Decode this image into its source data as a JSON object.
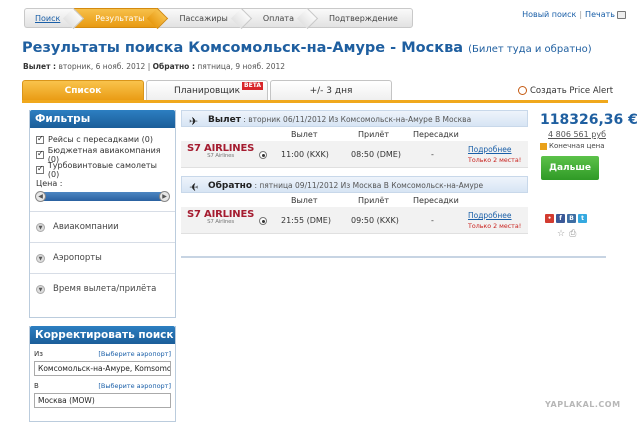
{
  "steps": [
    {
      "label": "Поиск",
      "state": "link"
    },
    {
      "label": "Результаты",
      "state": "active"
    },
    {
      "label": "Пассажиры",
      "state": "normal"
    },
    {
      "label": "Оплата",
      "state": "normal"
    },
    {
      "label": "Подтверждение",
      "state": "normal"
    }
  ],
  "toplinks": {
    "new_search": "Новый поиск",
    "separator": "|",
    "print": "Печать"
  },
  "title": {
    "main": "Результаты поиска Комсомольск-на-Амуре - Москва",
    "sub": "(Билет туда и обратно)"
  },
  "dates": {
    "depart_label": "Вылет :",
    "depart_value": "вторник, 6 нояб. 2012",
    "separator": "|",
    "return_label": "Обратно :",
    "return_value": "пятница, 9 нояб. 2012"
  },
  "tabs": [
    {
      "label": "Список",
      "active": true
    },
    {
      "label": "Планировщик",
      "badge": "BETA"
    },
    {
      "label": "+/- 3 дня"
    }
  ],
  "price_alert": "Создать Price Alert",
  "filters": {
    "title": "Фильтры",
    "checkboxes": [
      {
        "label": "Рейсы с пересадками (0)",
        "checked": true
      },
      {
        "label": "Бюджетная авиакомпания (0)",
        "checked": true
      },
      {
        "label": "Турбовинтовые самолеты (0)",
        "checked": true
      }
    ],
    "price_label": "Цена :",
    "accordions": [
      "Авиакомпании",
      "Аэропорты",
      "Время вылета/прилёта"
    ]
  },
  "correct_search": {
    "title": "Корректировать поиск",
    "from_label": "Из",
    "from_pick": "[Выберите аэропорт]",
    "from_value": "Комсомольск-на-Амуре, Komsomol",
    "to_label": "В",
    "to_pick": "[Выберите аэропорт]",
    "to_value": "Москва (MOW)"
  },
  "segments": [
    {
      "title": "Вылет",
      "detail": ": вторник 06/11/2012 Из Комсомольск-на-Амуре В Москва",
      "col_depart": "Вылет",
      "col_arrive": "Прилёт",
      "col_transfers": "Пересадки",
      "airline": "S7 AIRLINES",
      "airline_sub": "S7 Airlines",
      "depart": "11:00 (KXK)",
      "arrive": "08:50 (DME)",
      "transfers": "-",
      "details": "Подробнее",
      "seats": "Только 2 места!"
    },
    {
      "title": "Обратно",
      "detail": ": пятница 09/11/2012 Из Москва В Комсомольск-на-Амуре",
      "col_depart": "Вылет",
      "col_arrive": "Прилёт",
      "col_transfers": "Пересадки",
      "airline": "S7 AIRLINES",
      "airline_sub": "S7 Airlines",
      "depart": "21:55 (DME)",
      "arrive": "09:50 (KXK)",
      "transfers": "-",
      "details": "Подробнее",
      "seats": "Только 2 места!"
    }
  ],
  "price": {
    "eur": "118326,36 €",
    "rub": "4 806 561 руб",
    "final": "Конечная цена",
    "next": "Дальше"
  },
  "watermark": "YAPLAKAL.COM",
  "colors": {
    "accent_orange": "#e99a12",
    "link_blue": "#1a5fa8",
    "header_blue": "#1b5d99",
    "green": "#2f9a26",
    "alert_red": "#c8201c"
  }
}
